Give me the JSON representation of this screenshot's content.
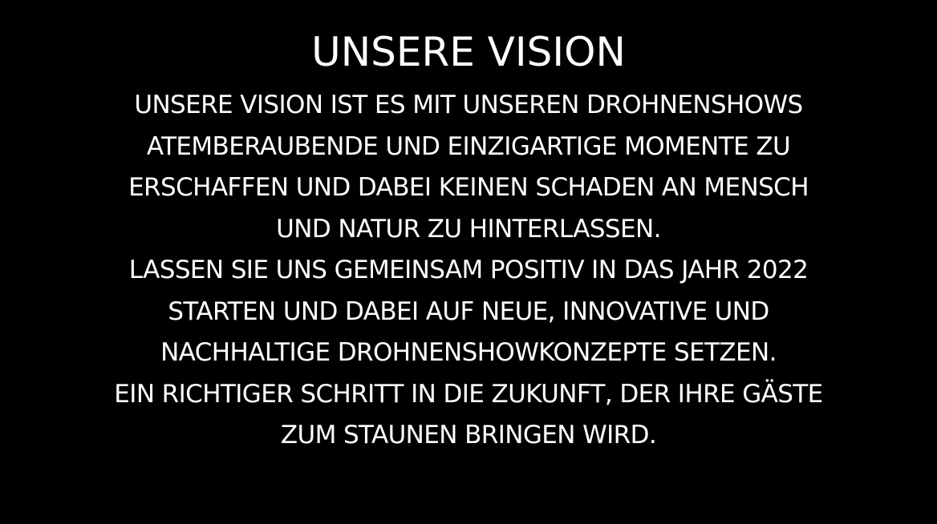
{
  "colors": {
    "background": "#000000",
    "text": "#ffffff"
  },
  "slide": {
    "title": "UNSERE VISION",
    "lines": [
      "UNSERE VISION IST ES MIT UNSEREN DROHNENSHOWS",
      "ATEMBERAUBENDE UND EINZIGARTIGE MOMENTE ZU",
      "ERSCHAFFEN UND DABEI KEINEN SCHADEN AN MENSCH",
      "UND NATUR ZU HINTERLASSEN.",
      "LASSEN SIE UNS GEMEINSAM POSITIV IN DAS JAHR 2022",
      "STARTEN UND DABEI AUF NEUE, INNOVATIVE UND",
      "NACHHALTIGE DROHNENSHOWKONZEPTE SETZEN.",
      "EIN RICHTIGER SCHRITT IN DIE ZUKUNFT, DER IHRE GÄSTE",
      "ZUM STAUNEN BRINGEN WIRD."
    ]
  }
}
